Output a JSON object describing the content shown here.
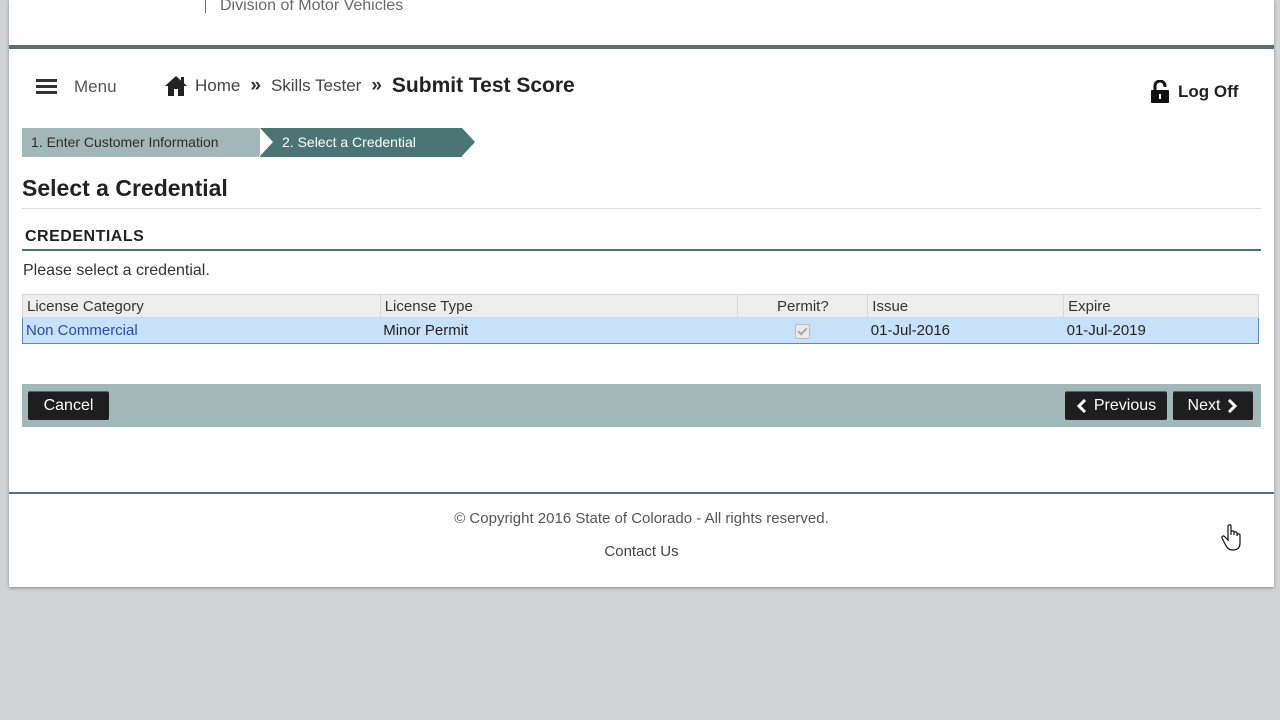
{
  "header": {
    "agency": "Division of Motor Vehicles"
  },
  "nav": {
    "menu_label": "Menu",
    "breadcrumb": {
      "home": "Home",
      "sep": "»",
      "skills_tester": "Skills Tester",
      "current": "Submit Test Score"
    },
    "logoff_label": "Log Off"
  },
  "wizard": {
    "steps": [
      {
        "label": "1. Enter Customer Information",
        "active": false
      },
      {
        "label": "2. Select a Credential",
        "active": true
      }
    ]
  },
  "page_title": "Select a Credential",
  "credentials": {
    "section_title": "CREDENTIALS",
    "instruction": "Please select a credential.",
    "columns": [
      "License Category",
      "License Type",
      "Permit?",
      "Issue",
      "Expire"
    ],
    "rows": [
      {
        "category": "Non Commercial",
        "type": "Minor Permit",
        "permit": true,
        "issue": "01-Jul-2016",
        "expire": "01-Jul-2019",
        "selected": true
      }
    ]
  },
  "actions": {
    "cancel": "Cancel",
    "previous": "Previous",
    "next": "Next"
  },
  "footer": {
    "copyright": "© Copyright 2016 State of Colorado - All rights reserved.",
    "contact": "Contact Us"
  },
  "colors": {
    "accent_dark": "#4b7475",
    "accent_light": "#a2b7b8",
    "selected_row": "#c7e1fb",
    "button": "#1e1e1e"
  }
}
